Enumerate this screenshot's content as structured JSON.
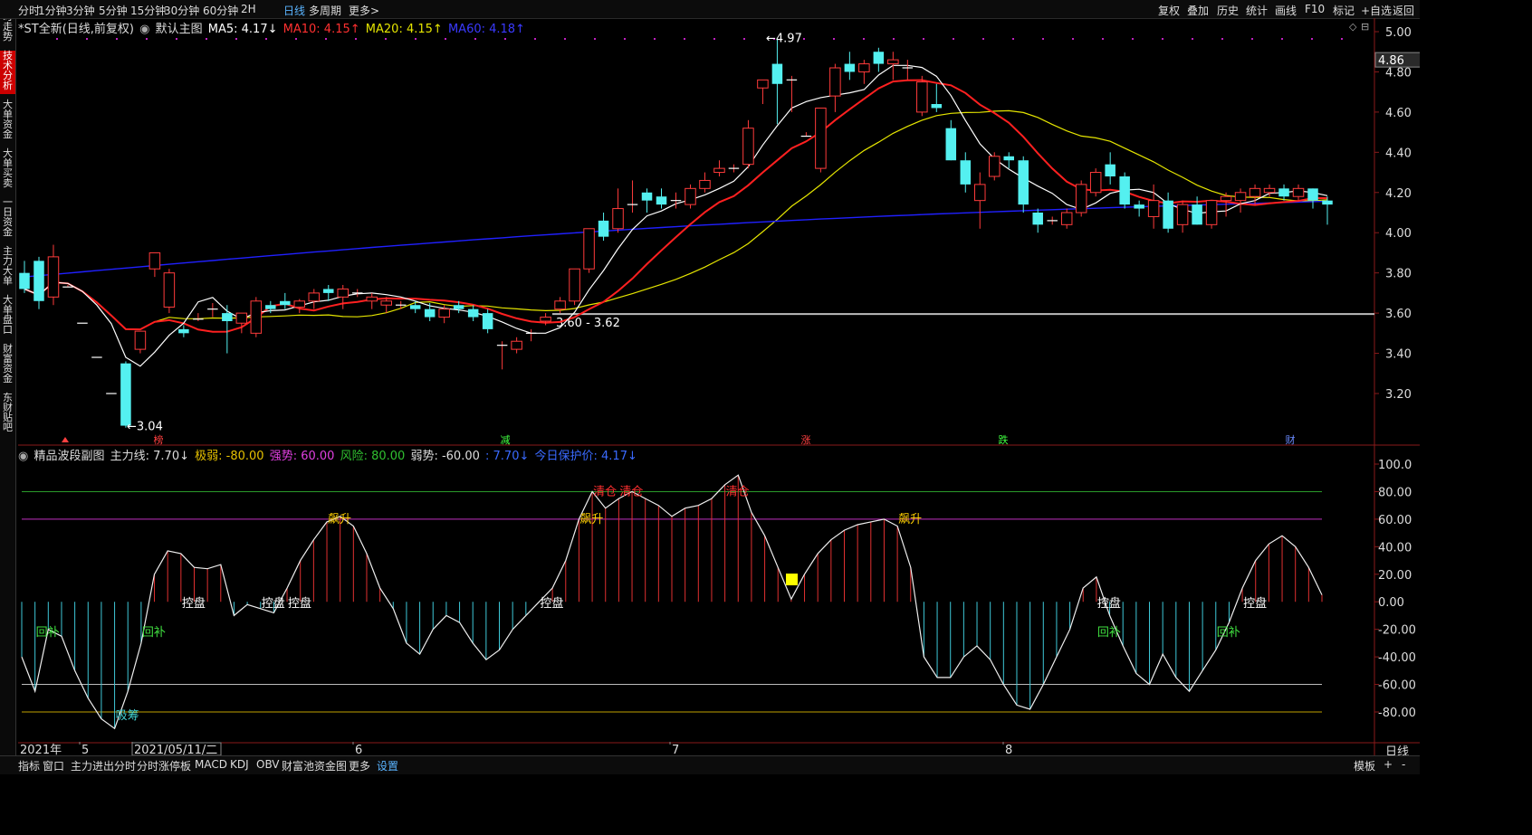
{
  "toolbar": {
    "periods": [
      "分时",
      "1分钟",
      "3分钟",
      "5分钟",
      "15分钟",
      "30分钟",
      "60分钟",
      "2H",
      "日线",
      "多周期",
      "更多>"
    ],
    "active_period": "日线",
    "right": [
      "复权",
      "叠加",
      "历史",
      "统计",
      "画线",
      "F10",
      "标记",
      "+自选",
      "返回"
    ]
  },
  "side_tabs": [
    "分时走势",
    "技术分析",
    "大单资金",
    "大单买卖",
    "一日资金",
    "主力大单",
    "大单盘口",
    "财富资金",
    "东财贴吧"
  ],
  "main_legend": {
    "name": "*ST全新(日线,前复权)",
    "indicator": "默认主图",
    "ma5": "MA5: 4.17↓",
    "ma10": "MA10: 4.15↑",
    "ma20": "MA20: 4.15↑",
    "ma60": "MA60: 4.18↑"
  },
  "sub_legend": {
    "name": "精品波段副图",
    "main": "主力线: 7.70↓",
    "weak_extreme": "极弱: -80.00",
    "strong": "强势: 60.00",
    "risk": "风险: 80.00",
    "weak": "弱势: -60.00",
    "val": ": 7.70↓",
    "protect": "今日保护价: 4.17↓"
  },
  "price_axis": [
    "5.00",
    "4.80",
    "4.60",
    "4.40",
    "4.20",
    "4.00",
    "3.80",
    "3.60",
    "3.40",
    "3.20"
  ],
  "current_price": "4.86",
  "osc_axis": [
    "100.0",
    "80.00",
    "60.00",
    "40.00",
    "20.00",
    "0.00",
    "-20.00",
    "-40.00",
    "-60.00",
    "-80.00"
  ],
  "x_labels": [
    "2021年",
    "5",
    "2021/05/11/二",
    "6",
    "7",
    "8"
  ],
  "annotations": {
    "high": "4.97",
    "low": "3.04",
    "range": "3.60 - 3.62"
  },
  "event_marks": [
    "榜",
    "减",
    "涨",
    "跌",
    "财"
  ],
  "osc_labels": {
    "chase": "飙升",
    "clear": "清仓",
    "control": "控盘",
    "refill": "回补",
    "absorb": "吸筹"
  },
  "bottom_tabs": [
    "指标",
    "窗口",
    "主力进出分时",
    "分时涨停板",
    "MACD",
    "KDJ",
    "OBV",
    "财富池资金图",
    "更多",
    "设置"
  ],
  "bottom_right": [
    "模板",
    "+",
    "-",
    "日线"
  ],
  "colors": {
    "up": "#ff3b3b",
    "down": "#54f0f0",
    "ma5": "#ffffff",
    "ma10": "#ff2020",
    "ma20": "#e5e500",
    "ma60": "#2020ff"
  },
  "chart_data": [
    {
      "type": "candlestick",
      "title": "*ST全新(日线,前复权)",
      "ylim": [
        3.0,
        5.05
      ],
      "series_note": "approximate daily OHLC read from chart",
      "ohlc": [
        [
          3.8,
          3.86,
          3.7,
          3.72
        ],
        [
          3.86,
          3.88,
          3.62,
          3.66
        ],
        [
          3.68,
          3.94,
          3.64,
          3.88
        ],
        [
          3.73,
          3.74,
          3.73,
          3.73
        ],
        [
          3.55,
          3.55,
          3.55,
          3.55
        ],
        [
          3.38,
          3.38,
          3.38,
          3.38
        ],
        [
          3.2,
          3.2,
          3.2,
          3.2
        ],
        [
          3.35,
          3.36,
          3.03,
          3.04
        ],
        [
          3.42,
          3.51,
          3.4,
          3.51
        ],
        [
          3.82,
          3.9,
          3.78,
          3.9
        ],
        [
          3.63,
          3.82,
          3.6,
          3.8
        ],
        [
          3.52,
          3.54,
          3.48,
          3.5
        ],
        [
          3.57,
          3.6,
          3.56,
          3.57
        ],
        [
          3.62,
          3.65,
          3.58,
          3.62
        ],
        [
          3.6,
          3.64,
          3.4,
          3.56
        ],
        [
          3.55,
          3.6,
          3.5,
          3.6
        ],
        [
          3.5,
          3.68,
          3.48,
          3.66
        ],
        [
          3.64,
          3.66,
          3.6,
          3.62
        ],
        [
          3.66,
          3.7,
          3.62,
          3.64
        ],
        [
          3.63,
          3.67,
          3.6,
          3.66
        ],
        [
          3.66,
          3.72,
          3.62,
          3.7
        ],
        [
          3.72,
          3.74,
          3.66,
          3.7
        ],
        [
          3.68,
          3.74,
          3.62,
          3.72
        ],
        [
          3.7,
          3.72,
          3.68,
          3.7
        ],
        [
          3.66,
          3.7,
          3.62,
          3.68
        ],
        [
          3.64,
          3.68,
          3.6,
          3.66
        ],
        [
          3.64,
          3.66,
          3.62,
          3.64
        ],
        [
          3.64,
          3.66,
          3.6,
          3.62
        ],
        [
          3.62,
          3.65,
          3.56,
          3.58
        ],
        [
          3.58,
          3.64,
          3.55,
          3.62
        ],
        [
          3.64,
          3.66,
          3.6,
          3.62
        ],
        [
          3.62,
          3.64,
          3.56,
          3.58
        ],
        [
          3.6,
          3.62,
          3.5,
          3.52
        ],
        [
          3.44,
          3.46,
          3.32,
          3.44
        ],
        [
          3.42,
          3.48,
          3.4,
          3.46
        ],
        [
          3.5,
          3.52,
          3.46,
          3.5
        ],
        [
          3.56,
          3.6,
          3.54,
          3.58
        ],
        [
          3.62,
          3.68,
          3.6,
          3.66
        ],
        [
          3.66,
          3.82,
          3.64,
          3.82
        ],
        [
          3.82,
          4.02,
          3.8,
          4.02
        ],
        [
          4.06,
          4.1,
          3.96,
          3.98
        ],
        [
          4.02,
          4.22,
          4.0,
          4.12
        ],
        [
          4.14,
          4.26,
          4.1,
          4.14
        ],
        [
          4.2,
          4.22,
          4.1,
          4.16
        ],
        [
          4.18,
          4.22,
          4.12,
          4.14
        ],
        [
          4.16,
          4.2,
          4.12,
          4.16
        ],
        [
          4.14,
          4.24,
          4.12,
          4.22
        ],
        [
          4.22,
          4.3,
          4.2,
          4.26
        ],
        [
          4.3,
          4.36,
          4.28,
          4.32
        ],
        [
          4.32,
          4.34,
          4.3,
          4.32
        ],
        [
          4.34,
          4.56,
          4.32,
          4.52
        ],
        [
          4.72,
          4.76,
          4.64,
          4.76
        ],
        [
          4.84,
          4.97,
          4.54,
          4.74
        ],
        [
          4.76,
          4.78,
          4.6,
          4.76
        ],
        [
          4.48,
          4.5,
          4.48,
          4.48
        ],
        [
          4.32,
          4.62,
          4.3,
          4.62
        ],
        [
          4.68,
          4.84,
          4.6,
          4.82
        ],
        [
          4.84,
          4.9,
          4.76,
          4.8
        ],
        [
          4.8,
          4.86,
          4.74,
          4.84
        ],
        [
          4.9,
          4.92,
          4.8,
          4.84
        ],
        [
          4.84,
          4.9,
          4.76,
          4.86
        ],
        [
          4.82,
          4.86,
          4.76,
          4.82
        ],
        [
          4.6,
          4.78,
          4.58,
          4.75
        ],
        [
          4.64,
          4.74,
          4.6,
          4.62
        ],
        [
          4.52,
          4.56,
          4.36,
          4.36
        ],
        [
          4.36,
          4.4,
          4.2,
          4.24
        ],
        [
          4.16,
          4.3,
          4.02,
          4.24
        ],
        [
          4.28,
          4.4,
          4.26,
          4.38
        ],
        [
          4.38,
          4.4,
          4.32,
          4.36
        ],
        [
          4.36,
          4.38,
          4.1,
          4.14
        ],
        [
          4.1,
          4.12,
          4.0,
          4.04
        ],
        [
          4.06,
          4.08,
          4.04,
          4.06
        ],
        [
          4.04,
          4.12,
          4.02,
          4.1
        ],
        [
          4.1,
          4.26,
          4.08,
          4.24
        ],
        [
          4.2,
          4.32,
          4.18,
          4.3
        ],
        [
          4.34,
          4.4,
          4.24,
          4.28
        ],
        [
          4.28,
          4.3,
          4.12,
          4.14
        ],
        [
          4.14,
          4.16,
          4.08,
          4.12
        ],
        [
          4.08,
          4.24,
          4.02,
          4.16
        ],
        [
          4.16,
          4.2,
          4.0,
          4.02
        ],
        [
          4.04,
          4.16,
          4.0,
          4.14
        ],
        [
          4.14,
          4.18,
          4.04,
          4.04
        ],
        [
          4.04,
          4.16,
          4.02,
          4.16
        ],
        [
          4.16,
          4.2,
          4.08,
          4.18
        ],
        [
          4.16,
          4.22,
          4.1,
          4.2
        ],
        [
          4.18,
          4.24,
          4.14,
          4.22
        ],
        [
          4.2,
          4.24,
          4.18,
          4.22
        ],
        [
          4.22,
          4.24,
          4.16,
          4.18
        ],
        [
          4.18,
          4.24,
          4.16,
          4.22
        ],
        [
          4.22,
          4.22,
          4.12,
          4.16
        ],
        [
          4.16,
          4.18,
          4.04,
          4.14
        ]
      ]
    },
    {
      "type": "area",
      "title": "精品波段副图",
      "ylim": [
        -92,
        106
      ],
      "levels": {
        "risk": 80,
        "strong": 60,
        "weak": -60,
        "weak_extreme": -80,
        "zero": 0
      },
      "values": [
        -40,
        -65,
        -20,
        -25,
        -50,
        -70,
        -85,
        -92,
        -65,
        -30,
        20,
        37,
        35,
        25,
        24,
        27,
        -10,
        -2,
        -5,
        -8,
        10,
        30,
        45,
        58,
        62,
        55,
        35,
        10,
        -5,
        -30,
        -38,
        -20,
        -10,
        -15,
        -30,
        -42,
        -35,
        -20,
        -10,
        0,
        10,
        30,
        60,
        80,
        68,
        75,
        80,
        75,
        70,
        62,
        68,
        70,
        75,
        85,
        92,
        65,
        48,
        25,
        2,
        20,
        35,
        45,
        52,
        56,
        58,
        60,
        55,
        25,
        -40,
        -55,
        -55,
        -40,
        -32,
        -42,
        -60,
        -75,
        -78,
        -60,
        -40,
        -20,
        10,
        18,
        -10,
        -32,
        -52,
        -60,
        -38,
        -55,
        -65,
        -50,
        -35,
        -15,
        10,
        30,
        42,
        48,
        40,
        25,
        5
      ],
      "label_x": [],
      "markers": [
        {
          "i": 1,
          "t": "回补"
        },
        {
          "i": 7,
          "t": "吸筹"
        },
        {
          "i": 9,
          "t": "回补"
        },
        {
          "i": 12,
          "t": "控盘"
        },
        {
          "i": 18,
          "t": "控盘"
        },
        {
          "i": 20,
          "t": "控盘"
        },
        {
          "i": 23,
          "t": "飙升"
        },
        {
          "i": 39,
          "t": "控盘"
        },
        {
          "i": 42,
          "t": "飙升"
        },
        {
          "i": 43,
          "t": "清仓"
        },
        {
          "i": 45,
          "t": "清仓"
        },
        {
          "i": 53,
          "t": "清仓"
        },
        {
          "i": 66,
          "t": "飙升"
        },
        {
          "i": 81,
          "t": "控盘"
        },
        {
          "i": 81,
          "t": "回补"
        },
        {
          "i": 90,
          "t": "回补"
        },
        {
          "i": 92,
          "t": "控盘"
        }
      ]
    }
  ]
}
